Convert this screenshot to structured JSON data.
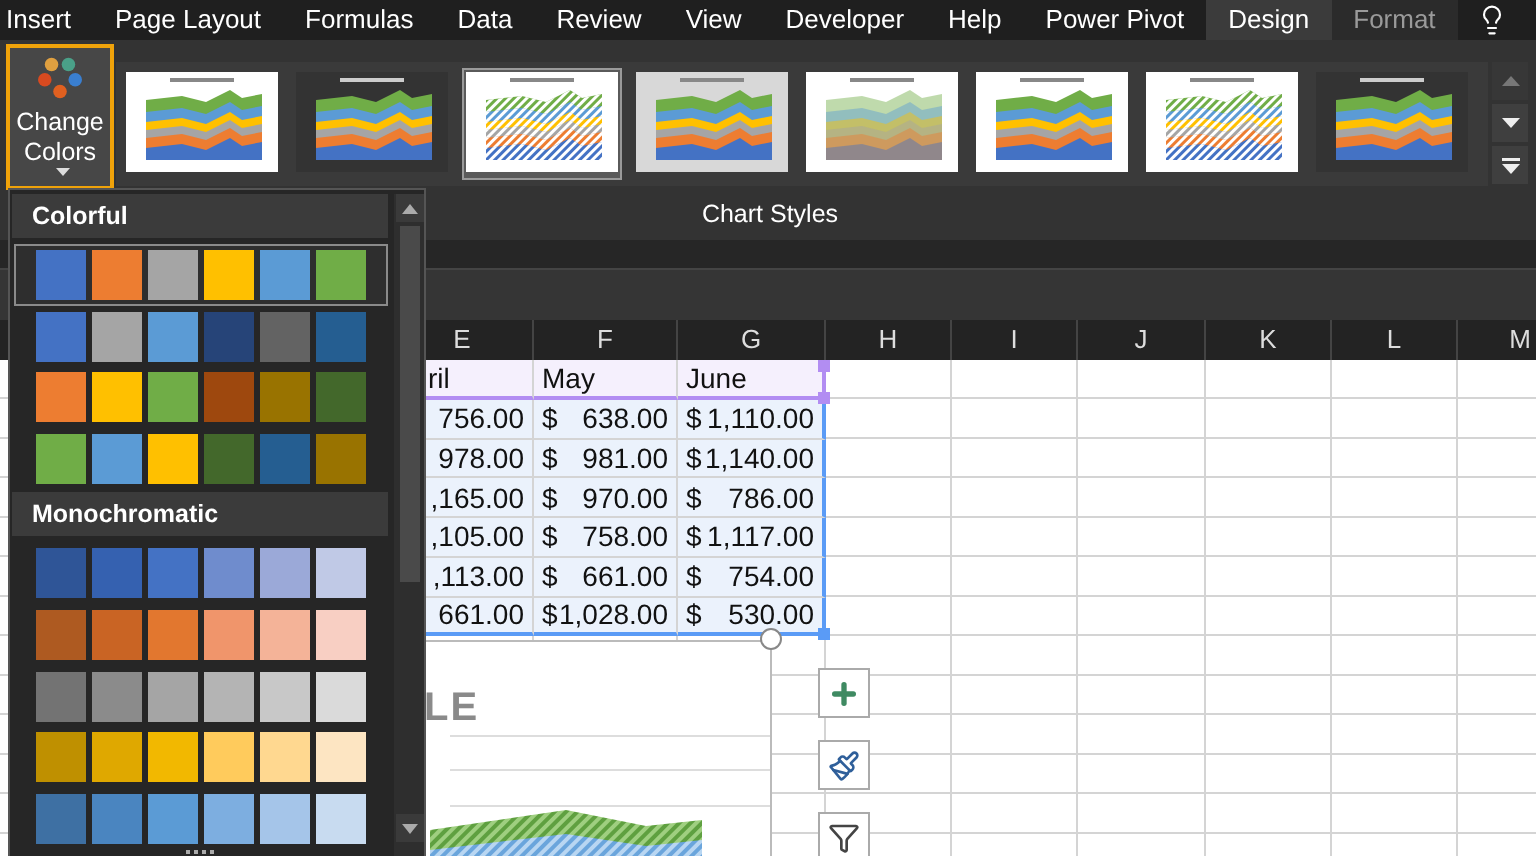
{
  "tabs": [
    {
      "label": "Insert",
      "selected": false,
      "contextual": false
    },
    {
      "label": "Page Layout",
      "selected": false,
      "contextual": false
    },
    {
      "label": "Formulas",
      "selected": false,
      "contextual": false
    },
    {
      "label": "Data",
      "selected": false,
      "contextual": false
    },
    {
      "label": "Review",
      "selected": false,
      "contextual": false
    },
    {
      "label": "View",
      "selected": false,
      "contextual": false
    },
    {
      "label": "Developer",
      "selected": false,
      "contextual": false
    },
    {
      "label": "Help",
      "selected": false,
      "contextual": false
    },
    {
      "label": "Power Pivot",
      "selected": false,
      "contextual": false
    },
    {
      "label": "Design",
      "selected": true,
      "contextual": true
    },
    {
      "label": "Format",
      "selected": false,
      "contextual": true
    }
  ],
  "ribbon": {
    "change_colors": {
      "label": "Change Colors",
      "expanded": true
    },
    "chart_styles": {
      "label": "Chart Styles",
      "thumbnails": [
        {
          "kind": "light",
          "selected": false
        },
        {
          "kind": "dark",
          "selected": false
        },
        {
          "kind": "hatched",
          "selected": true
        },
        {
          "kind": "shaded",
          "selected": false
        },
        {
          "kind": "pale",
          "selected": false
        },
        {
          "kind": "light",
          "selected": false
        },
        {
          "kind": "hatched",
          "selected": false
        },
        {
          "kind": "dark",
          "selected": false
        }
      ]
    }
  },
  "color_menu": {
    "sections": [
      {
        "title": "Colorful",
        "palettes": [
          {
            "selected": true,
            "swatches": [
              {
                "color": "#4472c4"
              },
              {
                "color": "#ed7d31"
              },
              {
                "color": "#a5a5a5"
              },
              {
                "color": "#ffc000"
              },
              {
                "color": "#5b9bd5"
              },
              {
                "color": "#70ad47"
              }
            ]
          },
          {
            "selected": false,
            "swatches": [
              {
                "color": "#4472c4"
              },
              {
                "color": "#a5a5a5"
              },
              {
                "color": "#5b9bd5"
              },
              {
                "color": "#264478"
              },
              {
                "color": "#636363"
              },
              {
                "color": "#255e91"
              }
            ]
          },
          {
            "selected": false,
            "swatches": [
              {
                "color": "#ed7d31"
              },
              {
                "color": "#ffc000"
              },
              {
                "color": "#70ad47"
              },
              {
                "color": "#9e480e"
              },
              {
                "color": "#997300"
              },
              {
                "color": "#43682b"
              }
            ]
          },
          {
            "selected": false,
            "swatches": [
              {
                "color": "#70ad47"
              },
              {
                "color": "#5b9bd5"
              },
              {
                "color": "#ffc000"
              },
              {
                "color": "#43682b"
              },
              {
                "color": "#255e91"
              },
              {
                "color": "#997300"
              }
            ]
          }
        ]
      },
      {
        "title": "Monochromatic",
        "palettes": [
          {
            "selected": false,
            "swatches": [
              {
                "color": "#2f5597"
              },
              {
                "color": "#3561b0"
              },
              {
                "color": "#4472c4"
              },
              {
                "color": "#6f8ccd"
              },
              {
                "color": "#9ba9d8"
              },
              {
                "color": "#c0c9e6"
              }
            ]
          },
          {
            "selected": false,
            "swatches": [
              {
                "color": "#ae5a21"
              },
              {
                "color": "#c96424"
              },
              {
                "color": "#e2772f"
              },
              {
                "color": "#f0956b"
              },
              {
                "color": "#f4b398"
              },
              {
                "color": "#f8cfc3"
              }
            ]
          },
          {
            "selected": false,
            "swatches": [
              {
                "color": "#737373"
              },
              {
                "color": "#8b8b8b"
              },
              {
                "color": "#a5a5a5"
              },
              {
                "color": "#b4b4b4"
              },
              {
                "color": "#c8c8c8"
              },
              {
                "color": "#dadada"
              }
            ]
          },
          {
            "selected": false,
            "swatches": [
              {
                "color": "#bf9000"
              },
              {
                "color": "#dfa800"
              },
              {
                "color": "#f2b800"
              },
              {
                "color": "#ffcb5c"
              },
              {
                "color": "#ffd890"
              },
              {
                "color": "#fde5c2"
              }
            ]
          },
          {
            "selected": false,
            "swatches": [
              {
                "color": "#3e70a3"
              },
              {
                "color": "#4a85c0"
              },
              {
                "color": "#5b9bd5"
              },
              {
                "color": "#7daee0"
              },
              {
                "color": "#a5c5e9"
              },
              {
                "color": "#c8dbf0"
              }
            ]
          }
        ]
      }
    ]
  },
  "sheet": {
    "columns": [
      "E",
      "F",
      "G",
      "H",
      "I",
      "J",
      "K",
      "L",
      "M"
    ],
    "header_row": [
      "ril",
      "May",
      "June"
    ],
    "rows": [
      [
        {
          "amount": "756.00"
        },
        {
          "currency": "$",
          "amount": "638.00"
        },
        {
          "currency": "$",
          "amount": "1,110.00"
        }
      ],
      [
        {
          "amount": "978.00"
        },
        {
          "currency": "$",
          "amount": "981.00"
        },
        {
          "currency": "$",
          "amount": "1,140.00"
        }
      ],
      [
        {
          "amount": ",165.00"
        },
        {
          "currency": "$",
          "amount": "970.00"
        },
        {
          "currency": "$",
          "amount": "786.00"
        }
      ],
      [
        {
          "amount": ",105.00"
        },
        {
          "currency": "$",
          "amount": "758.00"
        },
        {
          "currency": "$",
          "amount": "1,117.00"
        }
      ],
      [
        {
          "amount": ",113.00"
        },
        {
          "currency": "$",
          "amount": "661.00"
        },
        {
          "currency": "$",
          "amount": "754.00"
        }
      ],
      [
        {
          "amount": "661.00"
        },
        {
          "currency": "$",
          "amount": "1,028.00"
        },
        {
          "currency": "$",
          "amount": "530.00"
        }
      ]
    ]
  },
  "chart": {
    "title": "LE"
  }
}
